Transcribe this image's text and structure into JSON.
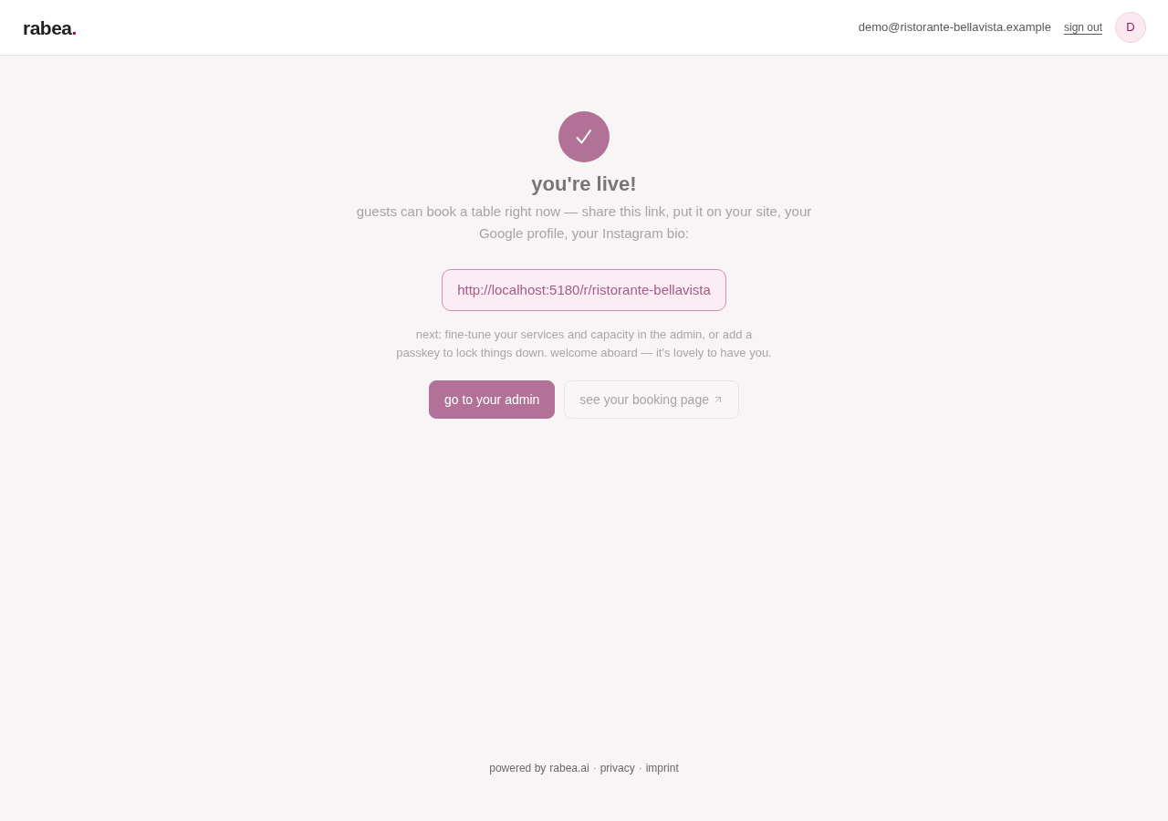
{
  "header": {
    "logo": {
      "text": "rabea",
      "mark": "."
    },
    "email": "demo@ristorante-bellavista.example",
    "sign_out": "sign out",
    "avatar": "D"
  },
  "hero": {
    "title": "you're live!",
    "description": "guests can book a table right now — share this link, put it on your site, your Google profile, your Instagram bio:",
    "booking_link": "http://localhost:5180/r/ristorante-bellavista",
    "next_steps": "next: fine-tune your services and capacity in the admin, or add a passkey to lock things down. welcome aboard — it's lovely to have you.",
    "buttons": [
      {
        "label": "go to your admin",
        "kind": "primary",
        "external": false
      },
      {
        "label": "see your booking page",
        "kind": "secondary",
        "external": true
      }
    ]
  },
  "footer": {
    "items": [
      {
        "kind": "text",
        "text": "powered by"
      },
      {
        "kind": "link",
        "text": "rabea.ai"
      },
      {
        "kind": "separator",
        "text": "·"
      },
      {
        "kind": "link",
        "text": "privacy"
      },
      {
        "kind": "separator",
        "text": "·"
      },
      {
        "kind": "link",
        "text": "imprint"
      }
    ]
  }
}
